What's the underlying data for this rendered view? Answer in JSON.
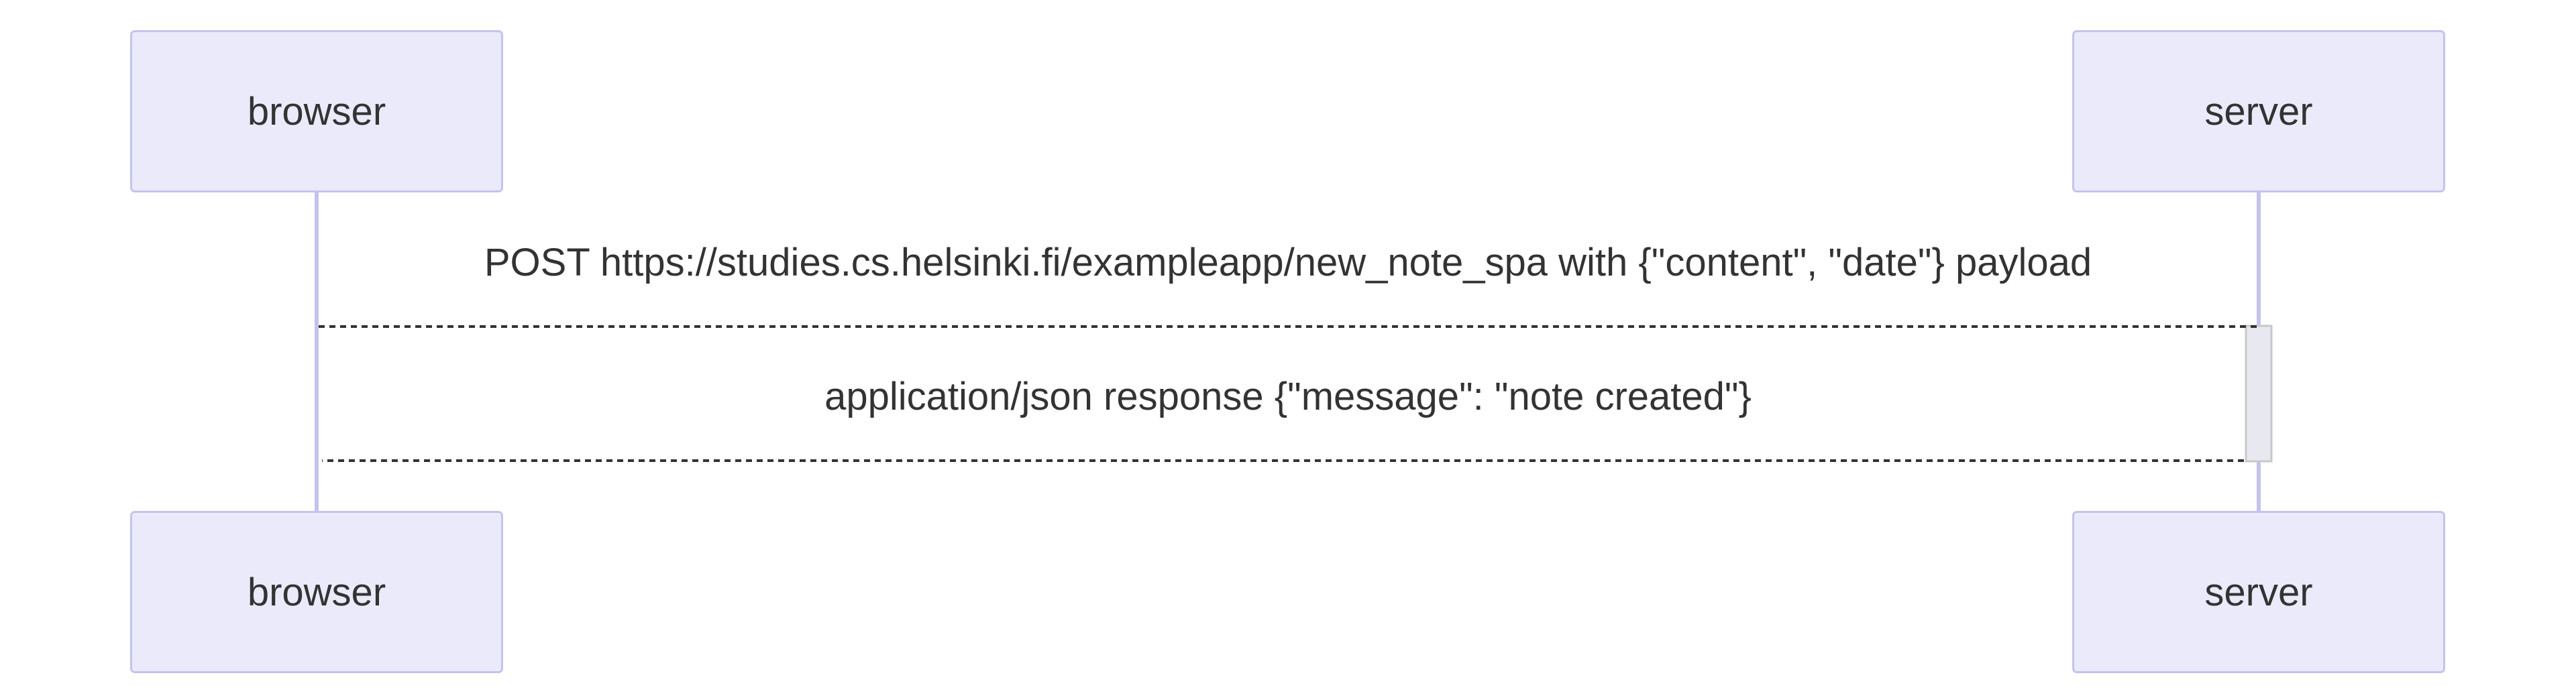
{
  "diagram": {
    "type": "sequence",
    "participants": [
      {
        "id": "browser",
        "label": "browser"
      },
      {
        "id": "server",
        "label": "server"
      }
    ],
    "messages": [
      {
        "from": "browser",
        "to": "server",
        "style": "dashed",
        "label": "POST https://studies.cs.helsinki.fi/exampleapp/new_note_spa with {\"content\", \"date\"} payload"
      },
      {
        "from": "server",
        "to": "browser",
        "style": "dashed",
        "label": "application/json response {\"message\": \"note created\"}"
      }
    ],
    "colors": {
      "actor_fill": "#eaeafb",
      "actor_border": "#c3c3ee",
      "lifeline": "#c3c3ee",
      "activation_fill": "#e8e8f0",
      "activation_border": "#c8c8c8",
      "message_line": "#333333",
      "text": "#333333"
    }
  }
}
